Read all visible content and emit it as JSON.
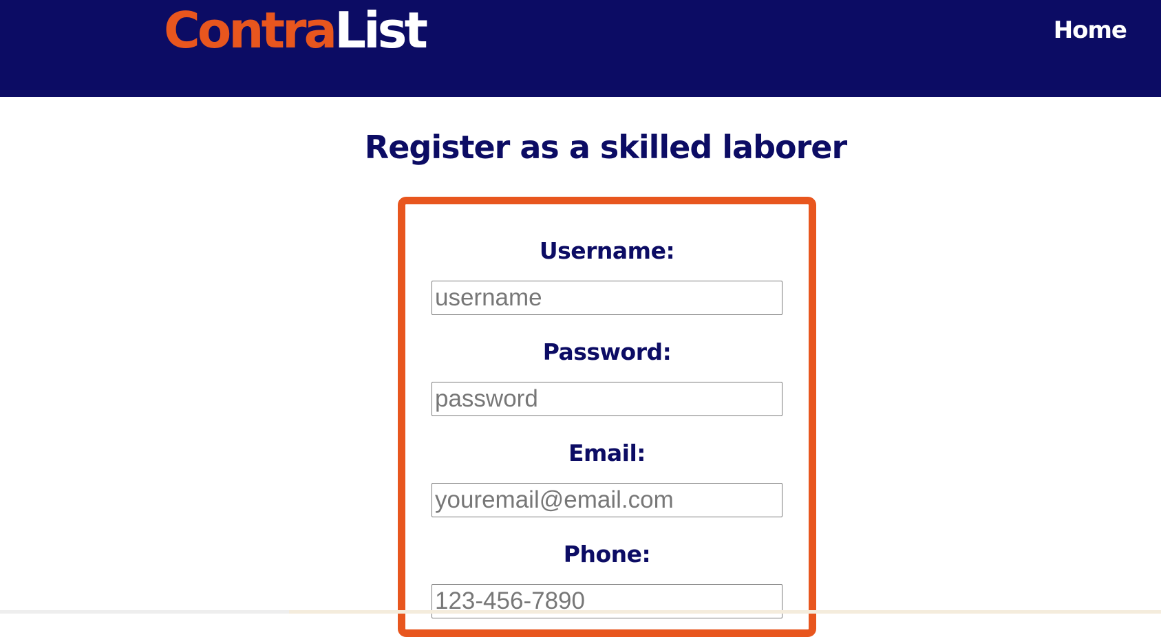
{
  "header": {
    "logo_part1": "Contra",
    "logo_part2": "List",
    "nav_home": "Home",
    "colors": {
      "background": "#0c0c64",
      "accent": "#e8561e",
      "text": "#ffffff"
    }
  },
  "main": {
    "title": "Register as a skilled laborer"
  },
  "form": {
    "fields": [
      {
        "label": "Username:",
        "placeholder": "username",
        "value": ""
      },
      {
        "label": "Password:",
        "placeholder": "password",
        "value": ""
      },
      {
        "label": "Email:",
        "placeholder": "youremail@email.com",
        "value": ""
      },
      {
        "label": "Phone:",
        "placeholder": "123-456-7890",
        "value": ""
      }
    ]
  }
}
